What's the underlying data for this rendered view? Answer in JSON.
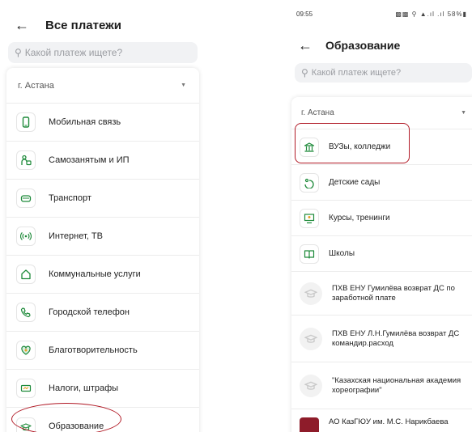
{
  "left": {
    "title": "Все платежи",
    "search_placeholder": "Какой платеж ищете?",
    "city": "г. Астана",
    "items": [
      {
        "label": "Мобильная связь",
        "icon": "phone-icon"
      },
      {
        "label": "Самозанятым и ИП",
        "icon": "person-icon"
      },
      {
        "label": "Транспорт",
        "icon": "car-icon"
      },
      {
        "label": "Интернет, ТВ",
        "icon": "wifi-icon"
      },
      {
        "label": "Коммунальные услуги",
        "icon": "house-icon"
      },
      {
        "label": "Городской телефон",
        "icon": "handset-icon"
      },
      {
        "label": "Благотворительность",
        "icon": "heart-icon"
      },
      {
        "label": "Налоги, штрафы",
        "icon": "receipt-icon"
      },
      {
        "label": "Образование",
        "icon": "graduation-cap-icon"
      }
    ]
  },
  "right": {
    "status": {
      "time": "09:55",
      "battery": "58%"
    },
    "title": "Образование",
    "search_placeholder": "Какой платеж ищете?",
    "city": "г. Астана",
    "items": [
      {
        "label": "ВУЗы, колледжи",
        "icon": "university-icon"
      },
      {
        "label": "Детские сады",
        "icon": "kindergarten-icon"
      },
      {
        "label": "Курсы, тренинги",
        "icon": "presentation-icon"
      },
      {
        "label": "Школы",
        "icon": "book-icon"
      },
      {
        "label": "ПХВ ЕНУ  Гумилёва возврат ДС по заработной плате",
        "icon": "graduation-cap-icon"
      },
      {
        "label": "ПХВ ЕНУ  Л.Н.Гумилёва возврат ДС  командир.расход",
        "icon": "graduation-cap-icon"
      },
      {
        "label": "\"Казахская национальная академия хореографии\"",
        "icon": "graduation-cap-icon"
      },
      {
        "label": "АО КазГЮУ им. М.С. Нарикбаева",
        "icon": "logo-icon"
      }
    ]
  },
  "colors": {
    "accent": "#1e8a3a",
    "annotation": "#b11a26"
  }
}
